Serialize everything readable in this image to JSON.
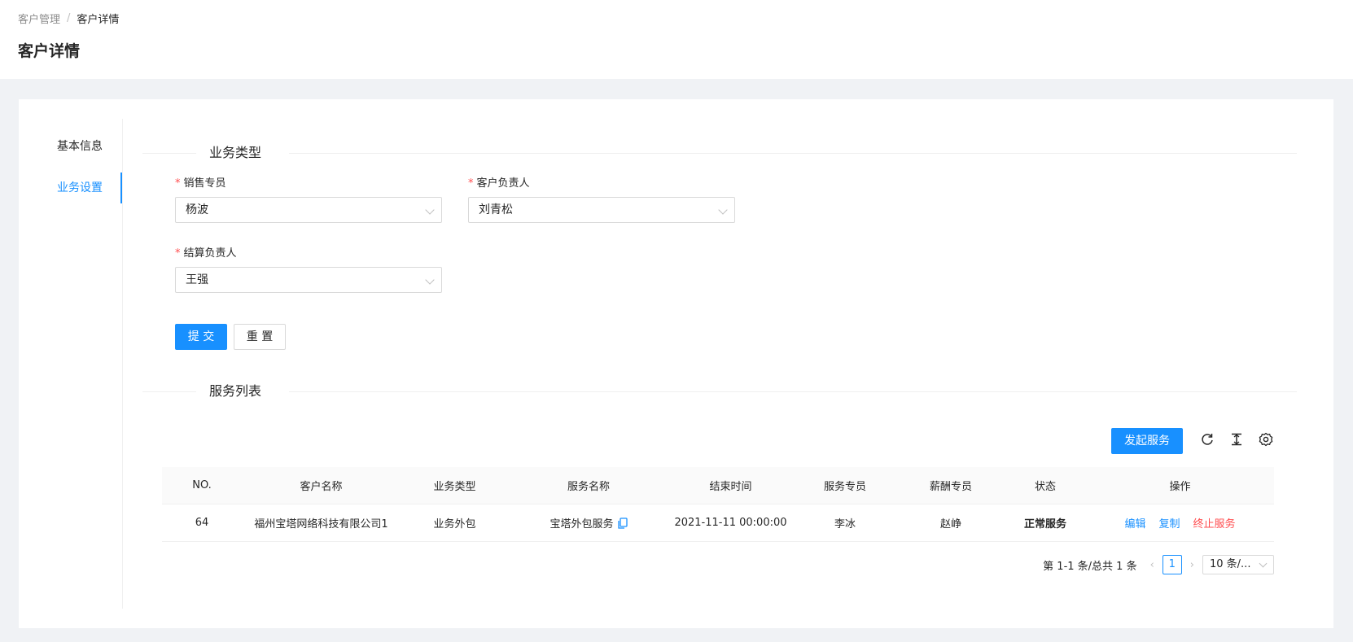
{
  "breadcrumb": {
    "parent": "客户管理",
    "separator": "/",
    "current": "客户详情"
  },
  "page_title": "客户详情",
  "side_menu": {
    "items": [
      {
        "label": "基本信息",
        "active": false
      },
      {
        "label": "业务设置",
        "active": true
      }
    ]
  },
  "business_type_section": {
    "title": "业务类型",
    "fields": {
      "sales": {
        "label": "销售专员",
        "value": "杨波"
      },
      "customer_owner": {
        "label": "客户负责人",
        "value": "刘青松"
      },
      "settlement_owner": {
        "label": "结算负责人",
        "value": "王强"
      }
    },
    "submit_label": "提 交",
    "reset_label": "重 置"
  },
  "service_list_section": {
    "title": "服务列表",
    "start_service_label": "发起服务",
    "toolbar_icons": [
      "reload-icon",
      "density-icon",
      "settings-icon"
    ],
    "columns": [
      "NO.",
      "客户名称",
      "业务类型",
      "服务名称",
      "结束时间",
      "服务专员",
      "薪酬专员",
      "状态",
      "操作"
    ],
    "rows": [
      {
        "no": "64",
        "customer_name": "福州宝塔网络科技有限公司1",
        "business_type": "业务外包",
        "service_name": "宝塔外包服务",
        "end_time": "2021-11-11 00:00:00",
        "service_specialist": "李冰",
        "payroll_specialist": "赵峥",
        "status": "正常服务",
        "actions": {
          "edit": "编辑",
          "copy": "复制",
          "terminate": "终止服务"
        }
      }
    ],
    "pagination": {
      "summary": "第 1-1 条/总共 1 条",
      "current_page": "1",
      "page_size": "10 条/..."
    }
  },
  "colors": {
    "primary": "#1890ff",
    "danger": "#ff4d4f",
    "required": "#ff4d4f",
    "page_bg": "#f0f2f5"
  }
}
